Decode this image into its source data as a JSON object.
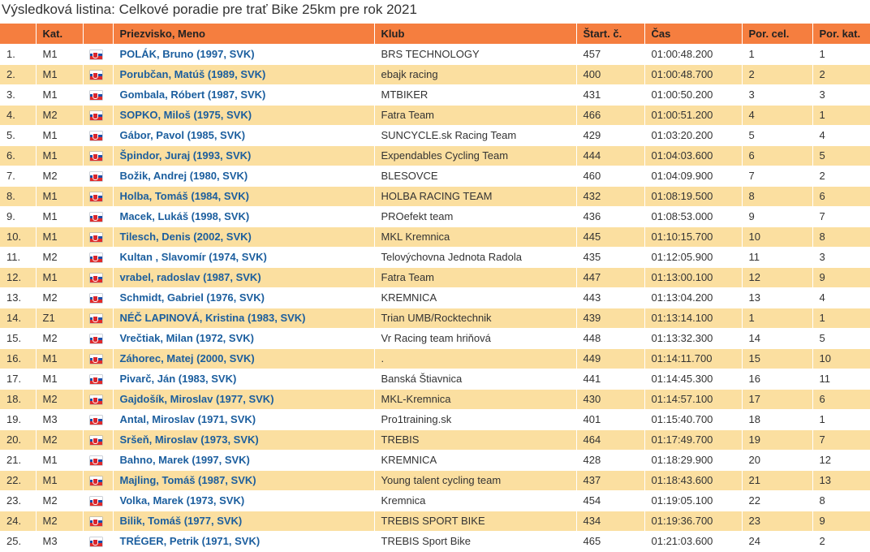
{
  "page": {
    "title": "Výsledková listina: Celkové poradie pre trať Bike 25km pre rok 2021"
  },
  "table": {
    "headers": [
      "",
      "Kat.",
      "",
      "Priezvisko, Meno",
      "Klub",
      "Štart. č.",
      "Čas",
      "Por. cel.",
      "Por. kat."
    ],
    "flag_icon": "slovakia-flag-icon",
    "rows": [
      {
        "rank": "1.",
        "cat": "M1",
        "name": "POLÁK, Bruno (1997, SVK)",
        "club": "BRS TECHNOLOGY",
        "bib": "457",
        "time": "01:00:48.200",
        "overall": "1",
        "cat_rank": "1"
      },
      {
        "rank": "2.",
        "cat": "M1",
        "name": "Porubčan, Matúš (1989, SVK)",
        "club": "ebajk racing",
        "bib": "400",
        "time": "01:00:48.700",
        "overall": "2",
        "cat_rank": "2"
      },
      {
        "rank": "3.",
        "cat": "M1",
        "name": "Gombala, Róbert (1987, SVK)",
        "club": "MTBIKER",
        "bib": "431",
        "time": "01:00:50.200",
        "overall": "3",
        "cat_rank": "3"
      },
      {
        "rank": "4.",
        "cat": "M2",
        "name": "SOPKO, Miloš (1975, SVK)",
        "club": "Fatra Team",
        "bib": "466",
        "time": "01:00:51.200",
        "overall": "4",
        "cat_rank": "1"
      },
      {
        "rank": "5.",
        "cat": "M1",
        "name": "Gábor, Pavol (1985, SVK)",
        "club": "SUNCYCLE.sk Racing Team",
        "bib": "429",
        "time": "01:03:20.200",
        "overall": "5",
        "cat_rank": "4"
      },
      {
        "rank": "6.",
        "cat": "M1",
        "name": "Špindor, Juraj (1993, SVK)",
        "club": "Expendables Cycling Team",
        "bib": "444",
        "time": "01:04:03.600",
        "overall": "6",
        "cat_rank": "5"
      },
      {
        "rank": "7.",
        "cat": "M2",
        "name": "Božik, Andrej (1980, SVK)",
        "club": "BLESOVCE",
        "bib": "460",
        "time": "01:04:09.900",
        "overall": "7",
        "cat_rank": "2"
      },
      {
        "rank": "8.",
        "cat": "M1",
        "name": "Holba, Tomáš (1984, SVK)",
        "club": "HOLBA RACING TEAM",
        "bib": "432",
        "time": "01:08:19.500",
        "overall": "8",
        "cat_rank": "6"
      },
      {
        "rank": "9.",
        "cat": "M1",
        "name": "Macek, Lukáš (1998, SVK)",
        "club": "PROefekt team",
        "bib": "436",
        "time": "01:08:53.000",
        "overall": "9",
        "cat_rank": "7"
      },
      {
        "rank": "10.",
        "cat": "M1",
        "name": "Tilesch, Denis (2002, SVK)",
        "club": "MKL Kremnica",
        "bib": "445",
        "time": "01:10:15.700",
        "overall": "10",
        "cat_rank": "8"
      },
      {
        "rank": "11.",
        "cat": "M2",
        "name": "Kultan , Slavomír (1974, SVK)",
        "club": "Telovýchovna Jednota Radola",
        "bib": "435",
        "time": "01:12:05.900",
        "overall": "11",
        "cat_rank": "3"
      },
      {
        "rank": "12.",
        "cat": "M1",
        "name": "vrabel, radoslav (1987, SVK)",
        "club": "Fatra Team",
        "bib": "447",
        "time": "01:13:00.100",
        "overall": "12",
        "cat_rank": "9"
      },
      {
        "rank": "13.",
        "cat": "M2",
        "name": "Schmidt, Gabriel (1976, SVK)",
        "club": "KREMNICA",
        "bib": "443",
        "time": "01:13:04.200",
        "overall": "13",
        "cat_rank": "4"
      },
      {
        "rank": "14.",
        "cat": "Z1",
        "name": "NÉČ LAPINOVÁ, Kristina (1983, SVK)",
        "club": "Trian UMB/Rocktechnik",
        "bib": "439",
        "time": "01:13:14.100",
        "overall": "1",
        "cat_rank": "1"
      },
      {
        "rank": "15.",
        "cat": "M2",
        "name": "Vrečtiak, Milan (1972, SVK)",
        "club": "Vr Racing team hriňová",
        "bib": "448",
        "time": "01:13:32.300",
        "overall": "14",
        "cat_rank": "5"
      },
      {
        "rank": "16.",
        "cat": "M1",
        "name": "Záhorec, Matej (2000, SVK)",
        "club": ".",
        "bib": "449",
        "time": "01:14:11.700",
        "overall": "15",
        "cat_rank": "10"
      },
      {
        "rank": "17.",
        "cat": "M1",
        "name": "Pivarč, Ján (1983, SVK)",
        "club": "Banská Štiavnica",
        "bib": "441",
        "time": "01:14:45.300",
        "overall": "16",
        "cat_rank": "11"
      },
      {
        "rank": "18.",
        "cat": "M2",
        "name": "Gajdošík, Miroslav (1977, SVK)",
        "club": "MKL-Kremnica",
        "bib": "430",
        "time": "01:14:57.100",
        "overall": "17",
        "cat_rank": "6"
      },
      {
        "rank": "19.",
        "cat": "M3",
        "name": "Antal, Miroslav (1971, SVK)",
        "club": "Pro1training.sk",
        "bib": "401",
        "time": "01:15:40.700",
        "overall": "18",
        "cat_rank": "1"
      },
      {
        "rank": "20.",
        "cat": "M2",
        "name": "Sršeň, Miroslav (1973, SVK)",
        "club": "TREBIS",
        "bib": "464",
        "time": "01:17:49.700",
        "overall": "19",
        "cat_rank": "7"
      },
      {
        "rank": "21.",
        "cat": "M1",
        "name": "Bahno, Marek (1997, SVK)",
        "club": "KREMNICA",
        "bib": "428",
        "time": "01:18:29.900",
        "overall": "20",
        "cat_rank": "12"
      },
      {
        "rank": "22.",
        "cat": "M1",
        "name": "Majling, Tomáš (1987, SVK)",
        "club": "Young talent cycling team",
        "bib": "437",
        "time": "01:18:43.600",
        "overall": "21",
        "cat_rank": "13"
      },
      {
        "rank": "23.",
        "cat": "M2",
        "name": "Volka, Marek (1973, SVK)",
        "club": "Kremnica",
        "bib": "454",
        "time": "01:19:05.100",
        "overall": "22",
        "cat_rank": "8"
      },
      {
        "rank": "24.",
        "cat": "M2",
        "name": "Bilik, Tomáš (1977, SVK)",
        "club": "TREBIS SPORT BIKE",
        "bib": "434",
        "time": "01:19:36.700",
        "overall": "23",
        "cat_rank": "9"
      },
      {
        "rank": "25.",
        "cat": "M3",
        "name": "TRÉGER, Petrik (1971, SVK)",
        "club": "TREBIS Sport Bike",
        "bib": "465",
        "time": "01:21:03.600",
        "overall": "24",
        "cat_rank": "2"
      }
    ]
  }
}
